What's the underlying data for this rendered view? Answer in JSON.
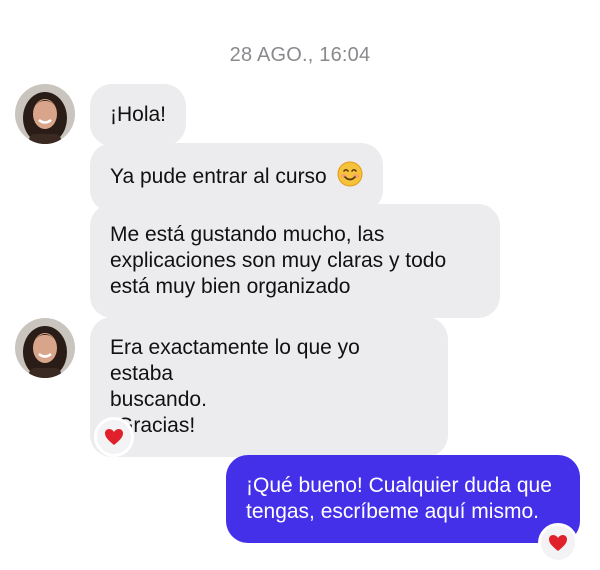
{
  "conversation": {
    "timestamp": "28 AGO., 16:04",
    "messages": [
      {
        "sender": "contact",
        "text": "¡Hola!"
      },
      {
        "sender": "contact",
        "text": "Ya pude entrar al curso",
        "emoji": "smiling-face-emoji"
      },
      {
        "sender": "contact",
        "text": "Me está gustando mucho, las\nexplicaciones son muy claras y todo\nestá muy bien organizado"
      },
      {
        "sender": "contact",
        "text": "Era exactamente lo que yo estaba\nbuscando.\n¡Gracias!",
        "reaction": "heart-icon"
      },
      {
        "sender": "me",
        "text": "¡Qué bueno! Cualquier duda que\ntengas, escríbeme aquí mismo.",
        "reaction": "heart-icon"
      }
    ]
  },
  "colors": {
    "incoming_bubble": "#ececee",
    "outgoing_bubble": "#4530ea",
    "timestamp_text": "#8a8a8e",
    "heart": "#e0202a"
  }
}
